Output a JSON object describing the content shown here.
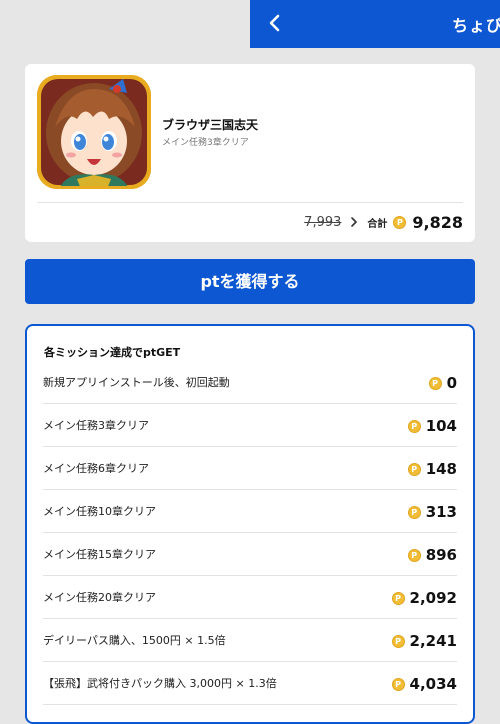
{
  "header": {
    "title": "ちょび"
  },
  "app": {
    "name": "ブラウザ三国志天",
    "subtitle": "メイン任務3章クリア",
    "old_price": "7,993",
    "total_label": "合計",
    "total_value": "9,828",
    "coin_symbol": "P"
  },
  "cta": {
    "label": "ptを獲得する"
  },
  "missions": {
    "title": "各ミッション達成でptGET",
    "items": [
      {
        "label": "新規アプリインストール後、初回起動",
        "points": "0"
      },
      {
        "label": "メイン任務3章クリア",
        "points": "104"
      },
      {
        "label": "メイン任務6章クリア",
        "points": "148"
      },
      {
        "label": "メイン任務10章クリア",
        "points": "313"
      },
      {
        "label": "メイン任務15章クリア",
        "points": "896"
      },
      {
        "label": "メイン任務20章クリア",
        "points": "2,092"
      },
      {
        "label": "デイリーパス購入、1500円 × 1.5倍",
        "points": "2,241"
      },
      {
        "label": "【張飛】武将付きパック購入 3,000円 × 1.3倍",
        "points": "4,034"
      }
    ]
  },
  "colors": {
    "primary": "#0d57d2",
    "coin": "#f1bd36",
    "background": "#e6e6e6"
  },
  "icons": {
    "back": "chevron-left-icon",
    "arrow": "chevron-right-icon",
    "coin": "point-coin-icon"
  }
}
